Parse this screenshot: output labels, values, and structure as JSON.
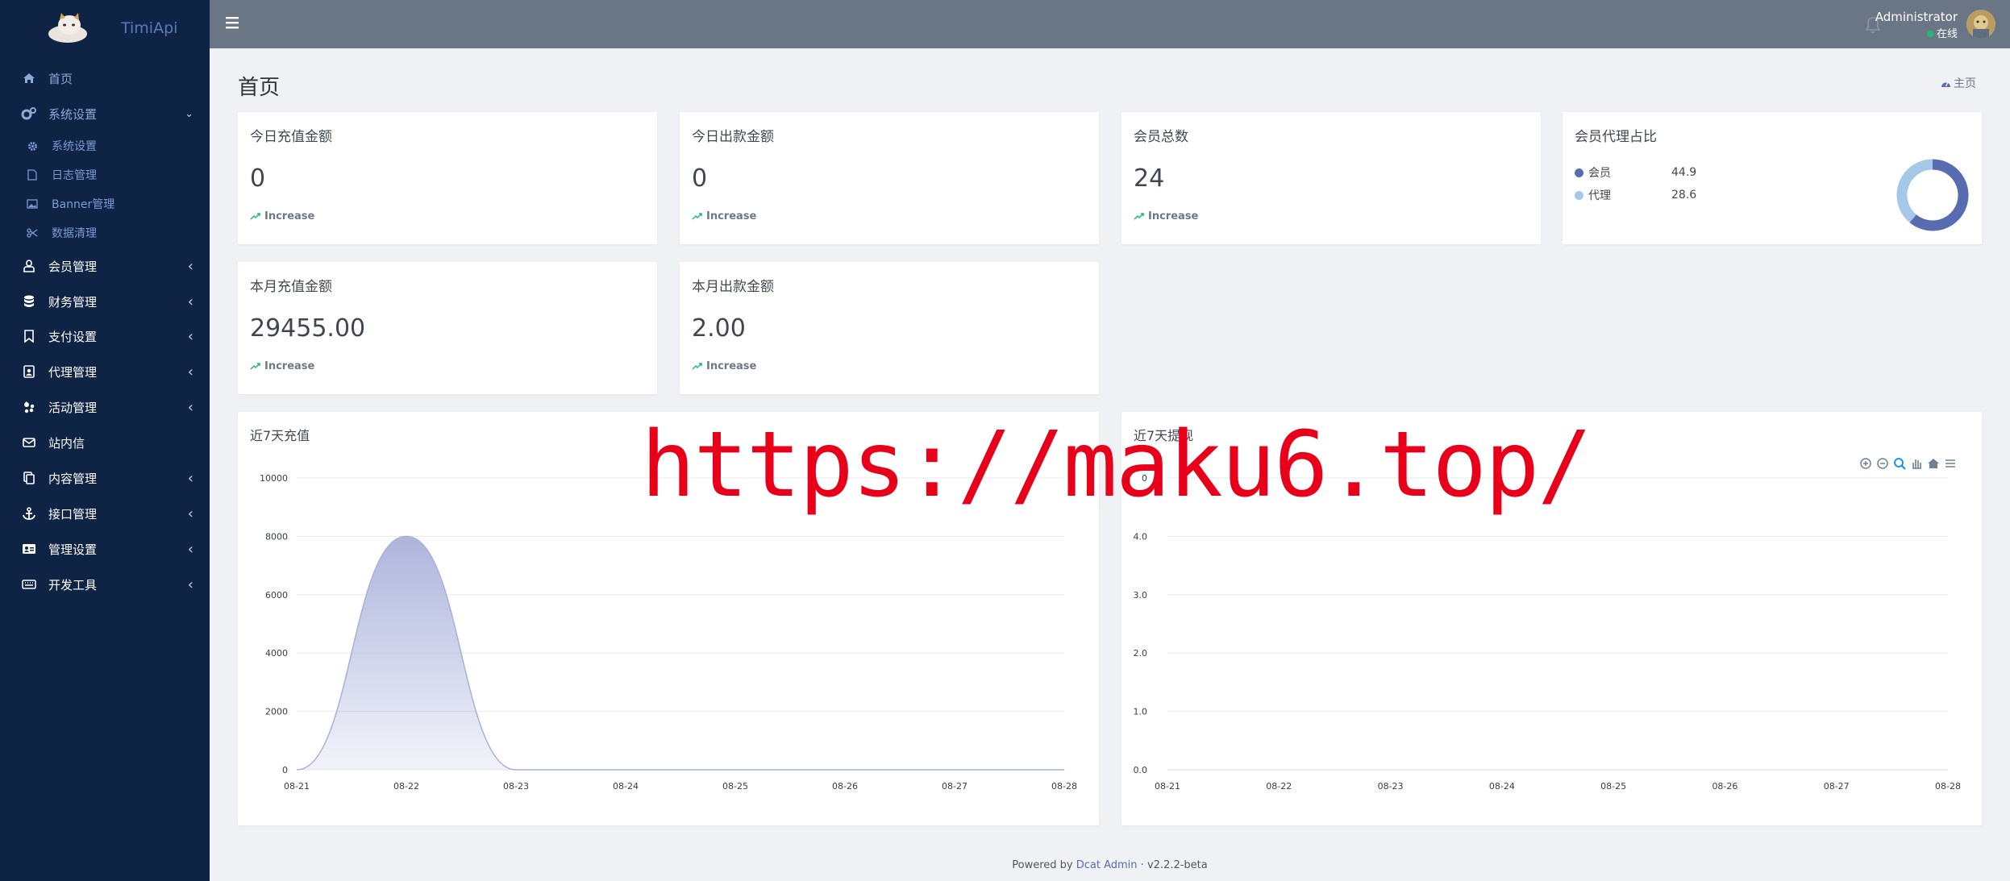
{
  "brand": {
    "name": "TimiApi"
  },
  "sidebar": {
    "items": [
      {
        "label": "首页"
      },
      {
        "label": "系统设置"
      },
      {
        "label": "系统设置"
      },
      {
        "label": "日志管理"
      },
      {
        "label": "Banner管理"
      },
      {
        "label": "数据清理"
      },
      {
        "label": "会员管理"
      },
      {
        "label": "财务管理"
      },
      {
        "label": "支付设置"
      },
      {
        "label": "代理管理"
      },
      {
        "label": "活动管理"
      },
      {
        "label": "站内信"
      },
      {
        "label": "内容管理"
      },
      {
        "label": "接口管理"
      },
      {
        "label": "管理设置"
      },
      {
        "label": "开发工具"
      }
    ]
  },
  "header": {
    "user_name": "Administrator",
    "user_status": "在线"
  },
  "page": {
    "title": "首页",
    "breadcrumb": "主页"
  },
  "cards": {
    "today_recharge": {
      "title": "今日充值金额",
      "value": "0",
      "trend": "Increase"
    },
    "today_withdraw": {
      "title": "今日出款金额",
      "value": "0",
      "trend": "Increase"
    },
    "member_total": {
      "title": "会员总数",
      "value": "24",
      "trend": "Increase"
    },
    "member_ratio": {
      "title": "会员代理占比",
      "legend": [
        {
          "label": "会员",
          "value": "44.9"
        },
        {
          "label": "代理",
          "value": "28.6"
        }
      ]
    },
    "month_recharge": {
      "title": "本月充值金额",
      "value": "29455.00",
      "trend": "Increase"
    },
    "month_withdraw": {
      "title": "本月出款金额",
      "value": "2.00",
      "trend": "Increase"
    }
  },
  "charts": {
    "recharge_title": "近7天充值",
    "withdraw_title": "近7天提现"
  },
  "chart_data": [
    {
      "type": "pie",
      "title": "会员代理占比",
      "labels": [
        "会员",
        "代理"
      ],
      "values": [
        44.9,
        28.6
      ],
      "colors": [
        "#586cb1",
        "#a6c8e8"
      ]
    },
    {
      "type": "area",
      "title": "近7天充值",
      "x": [
        "08-21",
        "08-22",
        "08-23",
        "08-24",
        "08-25",
        "08-26",
        "08-27",
        "08-28"
      ],
      "y_ticks": [
        "0",
        "2000",
        "4000",
        "6000",
        "8000",
        "10000"
      ],
      "ylim": [
        0,
        10000
      ],
      "series": [
        {
          "values": [
            0,
            8000,
            0,
            0,
            0,
            0,
            0,
            0
          ]
        }
      ],
      "color": "#a9b1db"
    },
    {
      "type": "area",
      "title": "近7天提现",
      "x": [
        "08-21",
        "08-22",
        "08-23",
        "08-24",
        "08-25",
        "08-26",
        "08-27",
        "08-28"
      ],
      "y_ticks": [
        "0.0",
        "1.0",
        "2.0",
        "3.0",
        "4.0",
        "0"
      ],
      "ylim": [
        0,
        5
      ],
      "series": [
        {
          "values": [
            0,
            0,
            0,
            0,
            0,
            0,
            0,
            0
          ]
        }
      ]
    }
  ],
  "watermark": "https://maku6.top/",
  "footer": {
    "prefix": "Powered by ",
    "link": "Dcat Admin",
    "separator": " · ",
    "version": "v2.2.2-beta"
  }
}
